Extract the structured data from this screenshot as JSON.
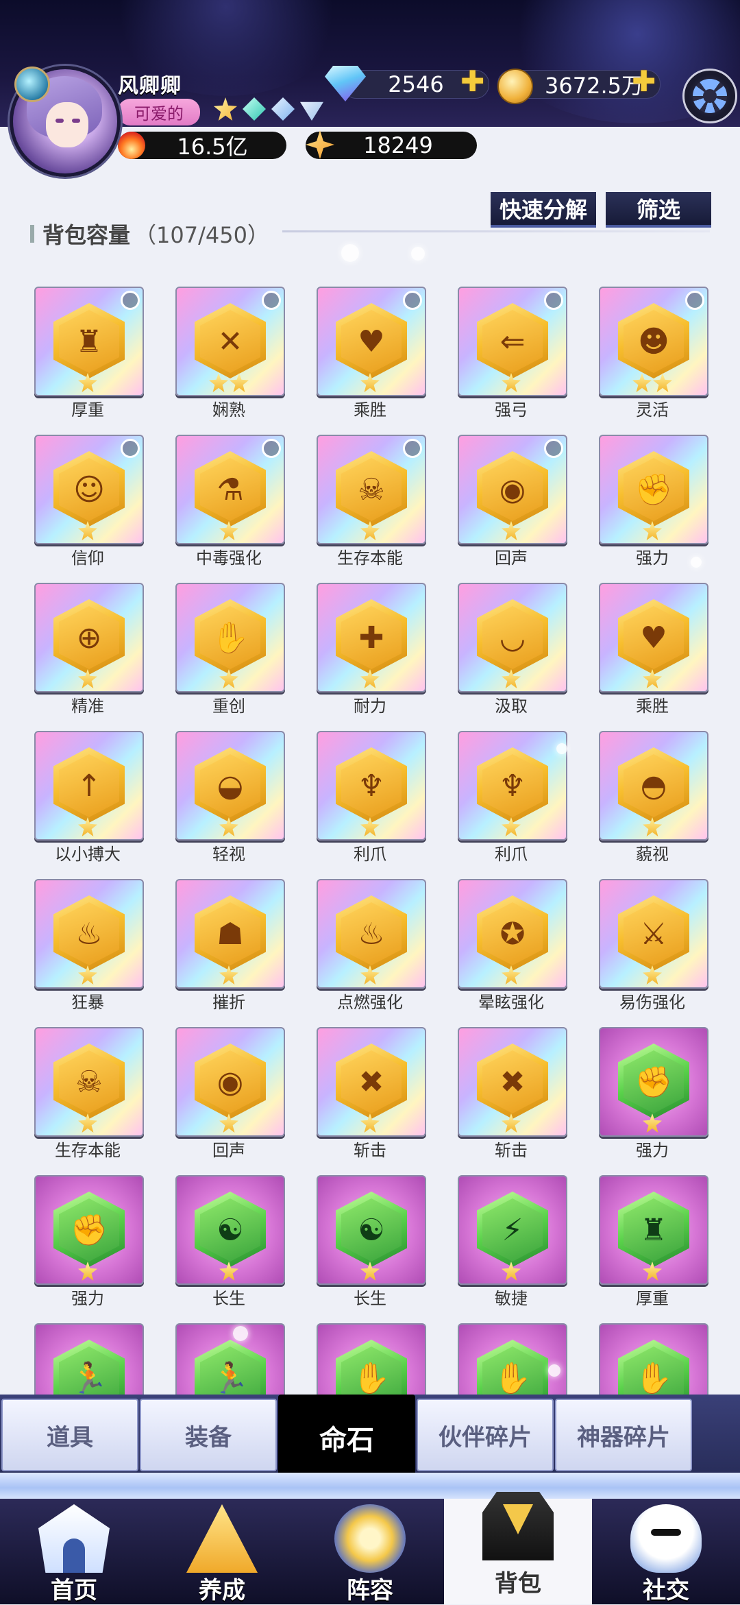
{
  "player": {
    "name": "风卿卿",
    "title_badge": "可爱的",
    "diamonds": "2546",
    "coins": "3672.5万",
    "power": "16.5亿",
    "stars": "18249"
  },
  "toolbar": {
    "quick_decompose": "快速分解",
    "filter": "筛选",
    "capacity_label": "背包容量",
    "capacity_count": "（107/450）"
  },
  "items": [
    {
      "name": "厚重",
      "stars": 1,
      "rarity": "gold",
      "marked": true,
      "icon": "figure-icon",
      "glyph": "♜"
    },
    {
      "name": "娴熟",
      "stars": 2,
      "rarity": "gold",
      "marked": true,
      "icon": "sword-icon",
      "glyph": "✕"
    },
    {
      "name": "乘胜",
      "stars": 1,
      "rarity": "gold",
      "marked": true,
      "icon": "broken-heart-icon",
      "glyph": "♥"
    },
    {
      "name": "强弓",
      "stars": 1,
      "rarity": "gold",
      "marked": true,
      "icon": "arrow-icon",
      "glyph": "⇐"
    },
    {
      "name": "灵活",
      "stars": 2,
      "rarity": "gold",
      "marked": true,
      "icon": "bomb-icon",
      "glyph": "☻"
    },
    {
      "name": "信仰",
      "stars": 1,
      "rarity": "gold",
      "marked": true,
      "icon": "halo-icon",
      "glyph": "☺"
    },
    {
      "name": "中毒强化",
      "stars": 1,
      "rarity": "gold",
      "marked": true,
      "icon": "flask-icon",
      "glyph": "⚗"
    },
    {
      "name": "生存本能",
      "stars": 1,
      "rarity": "gold",
      "marked": true,
      "icon": "skull-icon",
      "glyph": "☠"
    },
    {
      "name": "回声",
      "stars": 1,
      "rarity": "gold",
      "marked": true,
      "icon": "shout-icon",
      "glyph": "◉"
    },
    {
      "name": "强力",
      "stars": 1,
      "rarity": "gold",
      "marked": false,
      "icon": "fist-icon",
      "glyph": "✊"
    },
    {
      "name": "精准",
      "stars": 1,
      "rarity": "gold",
      "marked": false,
      "icon": "crosshair-icon",
      "glyph": "⊕"
    },
    {
      "name": "重创",
      "stars": 1,
      "rarity": "gold",
      "marked": false,
      "icon": "punch-icon",
      "glyph": "✋"
    },
    {
      "name": "耐力",
      "stars": 1,
      "rarity": "gold",
      "marked": false,
      "icon": "shield-cross-icon",
      "glyph": "✚"
    },
    {
      "name": "汲取",
      "stars": 1,
      "rarity": "gold",
      "marked": false,
      "icon": "lips-icon",
      "glyph": "◡"
    },
    {
      "name": "乘胜",
      "stars": 1,
      "rarity": "gold",
      "marked": false,
      "icon": "broken-heart-icon",
      "glyph": "♥"
    },
    {
      "name": "以小搏大",
      "stars": 1,
      "rarity": "gold",
      "marked": false,
      "icon": "arrow-bomb-icon",
      "glyph": "↑"
    },
    {
      "name": "轻视",
      "stars": 1,
      "rarity": "gold",
      "marked": false,
      "icon": "eye-shield-icon",
      "glyph": "◒"
    },
    {
      "name": "利爪",
      "stars": 1,
      "rarity": "gold",
      "marked": false,
      "icon": "claw-icon",
      "glyph": "♆"
    },
    {
      "name": "利爪",
      "stars": 1,
      "rarity": "gold",
      "marked": false,
      "icon": "claw-icon",
      "glyph": "♆"
    },
    {
      "name": "藐视",
      "stars": 1,
      "rarity": "gold",
      "marked": false,
      "icon": "mask-icon",
      "glyph": "◓"
    },
    {
      "name": "狂暴",
      "stars": 1,
      "rarity": "gold",
      "marked": false,
      "icon": "flame-face-icon",
      "glyph": "♨"
    },
    {
      "name": "摧折",
      "stars": 1,
      "rarity": "gold",
      "marked": false,
      "icon": "demon-icon",
      "glyph": "☗"
    },
    {
      "name": "点燃强化",
      "stars": 1,
      "rarity": "gold",
      "marked": false,
      "icon": "fire-icon",
      "glyph": "♨"
    },
    {
      "name": "晕眩强化",
      "stars": 1,
      "rarity": "gold",
      "marked": false,
      "icon": "dizzy-icon",
      "glyph": "✪"
    },
    {
      "name": "易伤强化",
      "stars": 1,
      "rarity": "gold",
      "marked": false,
      "icon": "blade-icon",
      "glyph": "⚔"
    },
    {
      "name": "生存本能",
      "stars": 1,
      "rarity": "gold",
      "marked": false,
      "icon": "skull-icon",
      "glyph": "☠"
    },
    {
      "name": "回声",
      "stars": 1,
      "rarity": "gold",
      "marked": false,
      "icon": "shout-icon",
      "glyph": "◉"
    },
    {
      "name": "斩击",
      "stars": 1,
      "rarity": "gold",
      "marked": false,
      "icon": "slash-icon",
      "glyph": "✖"
    },
    {
      "name": "斩击",
      "stars": 1,
      "rarity": "gold",
      "marked": false,
      "icon": "slash-icon",
      "glyph": "✖"
    },
    {
      "name": "强力",
      "stars": 1,
      "rarity": "green",
      "marked": false,
      "icon": "fist-icon",
      "glyph": "✊"
    },
    {
      "name": "强力",
      "stars": 1,
      "rarity": "green",
      "marked": false,
      "icon": "fist-icon",
      "glyph": "✊"
    },
    {
      "name": "长生",
      "stars": 1,
      "rarity": "green",
      "marked": false,
      "icon": "yinyang-icon",
      "glyph": "☯"
    },
    {
      "name": "长生",
      "stars": 1,
      "rarity": "green",
      "marked": false,
      "icon": "yinyang-icon",
      "glyph": "☯"
    },
    {
      "name": "敏捷",
      "stars": 1,
      "rarity": "green",
      "marked": false,
      "icon": "lightning-icon",
      "glyph": "⚡"
    },
    {
      "name": "厚重",
      "stars": 1,
      "rarity": "green",
      "marked": false,
      "icon": "figure-icon",
      "glyph": "♜"
    },
    {
      "name": "",
      "stars": 0,
      "rarity": "green",
      "marked": false,
      "icon": "runner-icon",
      "glyph": "🏃"
    },
    {
      "name": "",
      "stars": 0,
      "rarity": "green",
      "marked": false,
      "icon": "runner-icon",
      "glyph": "🏃"
    },
    {
      "name": "",
      "stars": 0,
      "rarity": "green",
      "marked": false,
      "icon": "punch-icon",
      "glyph": "✋"
    },
    {
      "name": "",
      "stars": 0,
      "rarity": "green",
      "marked": false,
      "icon": "punch-icon",
      "glyph": "✋"
    },
    {
      "name": "",
      "stars": 0,
      "rarity": "green",
      "marked": false,
      "icon": "punch-icon",
      "glyph": "✋"
    }
  ],
  "category_tabs": [
    {
      "label": "道具",
      "active": false
    },
    {
      "label": "装备",
      "active": false
    },
    {
      "label": "命石",
      "active": true
    },
    {
      "label": "伙伴碎片",
      "active": false
    },
    {
      "label": "神器碎片",
      "active": false
    }
  ],
  "nav": [
    {
      "label": "首页",
      "icon": "home-icon",
      "active": false
    },
    {
      "label": "养成",
      "icon": "train-icon",
      "active": false
    },
    {
      "label": "阵容",
      "icon": "team-icon",
      "active": false
    },
    {
      "label": "背包",
      "icon": "bag-icon",
      "active": true
    },
    {
      "label": "社交",
      "icon": "social-icon",
      "active": false
    }
  ]
}
